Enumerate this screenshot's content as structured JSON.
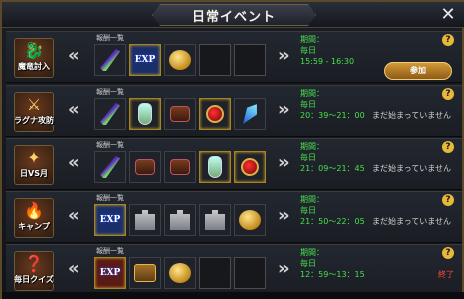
{
  "window": {
    "title": "日常イベント",
    "close_glyph": "✕"
  },
  "reward_header": "報酬一覧",
  "events": [
    {
      "name": "魔竜討入",
      "period_label": "期間：",
      "days": "毎日",
      "time": "15:59 - 16:30",
      "status": "",
      "action": "参加",
      "icon": "dragon-icon",
      "rewards": [
        "feather",
        "exp",
        "coin",
        "empty",
        "empty"
      ]
    },
    {
      "name": "ラグナ攻防",
      "period_label": "期間：",
      "days": "毎日",
      "time": "20：39～21：00",
      "status": "まだ始まっていません",
      "action": "",
      "icon": "castle-icon",
      "rewards": [
        "feather",
        "potion",
        "scroll",
        "gem-box",
        "crystal"
      ]
    },
    {
      "name": "日VS月",
      "period_label": "期間：",
      "days": "毎日",
      "time": "21：09～21：45",
      "status": "まだ始まっていません",
      "action": "",
      "icon": "crest-icon",
      "rewards": [
        "feather",
        "scroll",
        "scroll",
        "potion",
        "gem-box"
      ]
    },
    {
      "name": "キャンプ",
      "period_label": "期間：",
      "days": "毎日",
      "time": "21：50～22：05",
      "status": "まだ始まっていません",
      "action": "",
      "icon": "campfire-icon",
      "rewards": [
        "exp",
        "puzzle",
        "puzzle",
        "puzzle",
        "coin"
      ]
    },
    {
      "name": "毎日クイズ",
      "period_label": "期間：",
      "days": "毎日",
      "time": "12：59～13：15",
      "status": "終了",
      "action": "",
      "icon": "quiz-icon",
      "rewards": [
        "exp-red",
        "chest",
        "coin",
        "empty",
        "empty"
      ]
    }
  ],
  "nav": {
    "left": "«",
    "right": "»"
  },
  "help_glyph": "?",
  "exp_text": "EXP"
}
